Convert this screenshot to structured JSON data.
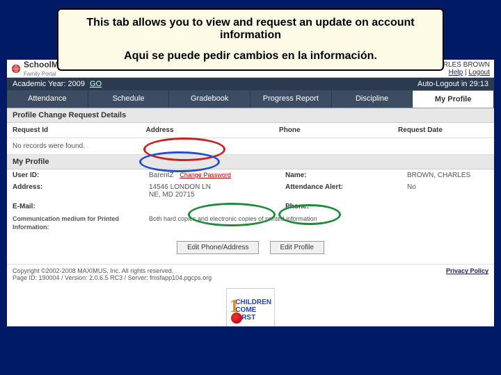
{
  "callout": {
    "line1": "This tab allows you to view and request an update on account information",
    "line2": "Aqui se puede pedir cambios en la información."
  },
  "branding": {
    "name": "SchoolMax",
    "sub": "Family Portal"
  },
  "toplinks": {
    "username": "CHARLES BROWN",
    "help": "Help",
    "logout": "Logout"
  },
  "yearbar": {
    "label": "Academic Year: 2009",
    "go": "GO",
    "autologout": "Auto-Logout in 29:13"
  },
  "tabs": {
    "items": [
      {
        "label": "Attendance"
      },
      {
        "label": "Schedule"
      },
      {
        "label": "Gradebook"
      },
      {
        "label": "Progress Report"
      },
      {
        "label": "Discipline"
      },
      {
        "label": "My Profile"
      }
    ],
    "active": 5
  },
  "sections": {
    "pcrd_title": "Profile Change Request Details",
    "profile_title": "My Profile",
    "columns": {
      "c1": "Request Id",
      "c2": "Address",
      "c3": "Phone",
      "c4": "Request Date"
    },
    "no_records": "No records were found."
  },
  "profile": {
    "user_id_label": "User ID:",
    "user_id_value": "BarentZ",
    "change_pw": "Change Password",
    "name_label": "Name:",
    "name_value": "BROWN, CHARLES",
    "address_label": "Address:",
    "address_value1": "14546 LONDON LN",
    "address_value2": "NE, MD 20715",
    "alert_label": "Attendance Alert:",
    "alert_value": "No",
    "email_label": "E-Mail:",
    "email_value": "",
    "phone_label": "Phone:",
    "phone_value": "",
    "comm_label": "Communication medium for Printed Information:",
    "comm_value": "Both hard copies and electronic copies of printed information"
  },
  "buttons": {
    "edit_phone": "Edit Phone/Address",
    "edit_profile": "Edit Profile"
  },
  "footer": {
    "copyright": "Copyright ©2002-2008 MAXIMUS, Inc. All rights reserved.",
    "pageid": "Page ID: 190004 / Version: 2.0.6.5 RC3 / Server: fmsfapp104.pgcps.org",
    "privacy": "Privacy Policy"
  },
  "childlogo": {
    "children": "CHILDREN",
    "come": "COME",
    "first": "FIRST"
  }
}
